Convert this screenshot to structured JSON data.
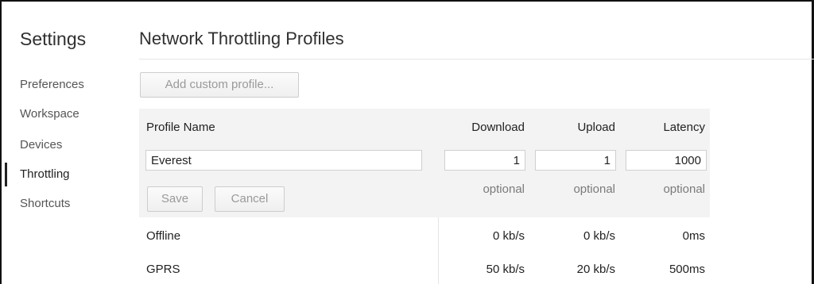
{
  "sidebar": {
    "title": "Settings",
    "items": [
      {
        "label": "Preferences"
      },
      {
        "label": "Workspace"
      },
      {
        "label": "Devices"
      },
      {
        "label": "Throttling"
      },
      {
        "label": "Shortcuts"
      }
    ],
    "selected": "Throttling"
  },
  "page": {
    "title": "Network Throttling Profiles",
    "add_button": "Add custom profile..."
  },
  "columns": {
    "name": "Profile Name",
    "download": "Download",
    "upload": "Upload",
    "latency": "Latency"
  },
  "editor": {
    "name_value": "Everest",
    "download_value": "1",
    "upload_value": "1",
    "latency_value": "1000",
    "optional": "optional",
    "save_label": "Save",
    "cancel_label": "Cancel"
  },
  "profiles": [
    {
      "name": "Offline",
      "download": "0 kb/s",
      "upload": "0 kb/s",
      "latency": "0ms"
    },
    {
      "name": "GPRS",
      "download": "50 kb/s",
      "upload": "20 kb/s",
      "latency": "500ms"
    }
  ]
}
